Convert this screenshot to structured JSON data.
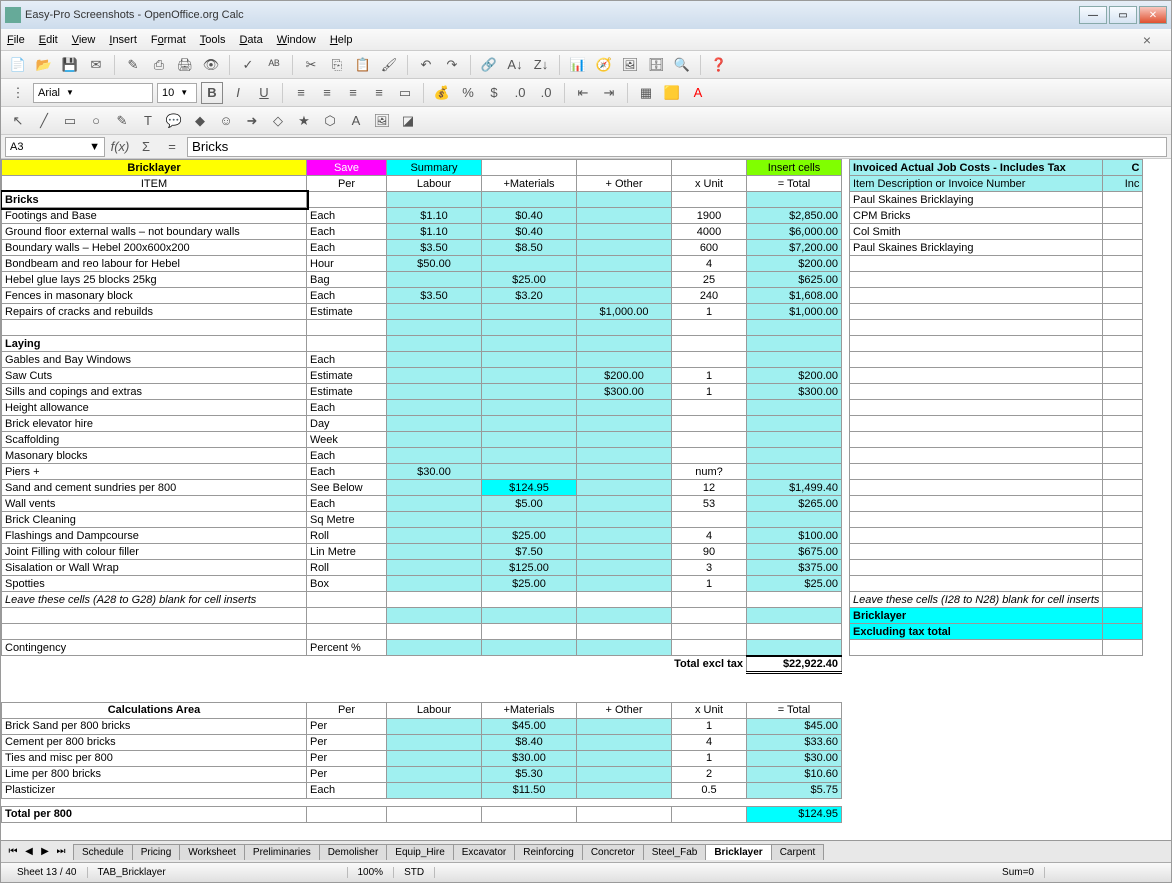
{
  "window_title": "Easy-Pro Screenshots - OpenOffice.org Calc",
  "menu": [
    "File",
    "Edit",
    "View",
    "Insert",
    "Format",
    "Tools",
    "Data",
    "Window",
    "Help"
  ],
  "font_name": "Arial",
  "font_size": "10",
  "cell_ref": "A3",
  "formula": "Bricks",
  "headers": {
    "bricklayer": "Bricklayer",
    "save": "Save",
    "summary": "Summary",
    "insert_cells": "Insert cells",
    "invoiced_title": "Invoiced Actual Job Costs - Includes Tax",
    "item": "ITEM",
    "per": "Per",
    "labour": "Labour",
    "materials": "+Materials",
    "other": "+ Other",
    "xunit": "x Unit",
    "total": "= Total",
    "item_desc": "Item Description or Invoice Number",
    "inc": "Inc",
    "inc_c": "C"
  },
  "sections": {
    "bricks": "Bricks",
    "laying": "Laying",
    "calc_area": "Calculations Area"
  },
  "rows": {
    "footings": {
      "item": "Footings and Base",
      "per": "Each",
      "lab": "$1.10",
      "mat": "$0.40",
      "unit": "1900",
      "tot": "$2,850.00"
    },
    "ground": {
      "item": "Ground floor external walls – not boundary walls",
      "per": "Each",
      "lab": "$1.10",
      "mat": "$0.40",
      "unit": "4000",
      "tot": "$6,000.00"
    },
    "boundary": {
      "item": "Boundary walls – Hebel 200x600x200",
      "per": "Each",
      "lab": "$3.50",
      "mat": "$8.50",
      "unit": "600",
      "tot": "$7,200.00"
    },
    "bondbeam": {
      "item": "Bondbeam and reo labour for Hebel",
      "per": "Hour",
      "lab": "$50.00",
      "unit": "4",
      "tot": "$200.00"
    },
    "hebelglue": {
      "item": "Hebel glue  lays 25 blocks 25kg",
      "per": "Bag",
      "mat": "$25.00",
      "unit": "25",
      "tot": "$625.00"
    },
    "fences": {
      "item": "Fences in masonary block",
      "per": "Each",
      "lab": "$3.50",
      "mat": "$3.20",
      "unit": "240",
      "tot": "$1,608.00"
    },
    "repairs": {
      "item": "Repairs of cracks and rebuilds",
      "per": "Estimate",
      "oth": "$1,000.00",
      "unit": "1",
      "tot": "$1,000.00"
    },
    "gables": {
      "item": "Gables and Bay Windows",
      "per": "Each"
    },
    "sawcuts": {
      "item": "Saw Cuts",
      "per": "Estimate",
      "oth": "$200.00",
      "unit": "1",
      "tot": "$200.00"
    },
    "sills": {
      "item": "Sills and copings and extras",
      "per": "Estimate",
      "oth": "$300.00",
      "unit": "1",
      "tot": "$300.00"
    },
    "height": {
      "item": "Height allowance",
      "per": "Each"
    },
    "elevator": {
      "item": "Brick elevator hire",
      "per": "Day"
    },
    "scaffold": {
      "item": "Scaffolding",
      "per": "Week"
    },
    "masonary": {
      "item": "Masonary blocks",
      "per": "Each"
    },
    "piers": {
      "item": "Piers +",
      "per": "Each",
      "lab": "$30.00",
      "unit": "num?"
    },
    "sand": {
      "item": "Sand and cement sundries per 800",
      "per": "See Below",
      "mat": "$124.95",
      "unit": "12",
      "tot": "$1,499.40"
    },
    "wallvents": {
      "item": "Wall vents",
      "per": "Each",
      "mat": "$5.00",
      "unit": "53",
      "tot": "$265.00"
    },
    "cleaning": {
      "item": "Brick Cleaning",
      "per": "Sq Metre"
    },
    "flashings": {
      "item": "Flashings and Dampcourse",
      "per": "Roll",
      "mat": "$25.00",
      "unit": "4",
      "tot": "$100.00"
    },
    "joint": {
      "item": "Joint Filling with colour filler",
      "per": "Lin Metre",
      "mat": "$7.50",
      "unit": "90",
      "tot": "$675.00"
    },
    "sisal": {
      "item": "Sisalation or Wall Wrap",
      "per": "Roll",
      "mat": "$125.00",
      "unit": "3",
      "tot": "$375.00"
    },
    "spotties": {
      "item": "Spotties",
      "per": "Box",
      "mat": "$25.00",
      "unit": "1",
      "tot": "$25.00"
    },
    "contingency": {
      "item": "Contingency",
      "per": "Percent %"
    },
    "bricksand": {
      "item": "Brick Sand per 800 bricks",
      "per": "Per",
      "mat": "$45.00",
      "unit": "1",
      "tot": "$45.00"
    },
    "cement": {
      "item": "Cement per 800 bricks",
      "per": "Per",
      "mat": "$8.40",
      "unit": "4",
      "tot": "$33.60"
    },
    "ties": {
      "item": "Ties and misc per 800",
      "per": "Per",
      "mat": "$30.00",
      "unit": "1",
      "tot": "$30.00"
    },
    "lime": {
      "item": "Lime per 800 bricks",
      "per": "Per",
      "mat": "$5.30",
      "unit": "2",
      "tot": "$10.60"
    },
    "plasticizer": {
      "item": "Plasticizer",
      "per": "Each",
      "mat": "$11.50",
      "unit": "0.5",
      "tot": "$5.75"
    },
    "totalper800": {
      "item": "Total per 800",
      "tot": "$124.95"
    }
  },
  "notes": {
    "leave1": "Leave these cells (A28 to G28) blank for cell inserts",
    "leave2": "Leave these cells (I28 to N28) blank for cell inserts",
    "total_excl": "Total excl tax",
    "total_val": "$22,922.40",
    "bricklayer_row": "Bricklayer",
    "excluding": "Excluding tax total"
  },
  "invoices": [
    "Paul Skaines Bricklaying",
    "CPM Bricks",
    "Col Smith",
    "Paul Skaines Bricklaying"
  ],
  "tabs": [
    "Schedule",
    "Pricing",
    "Worksheet",
    "Preliminaries",
    "Demolisher",
    "Equip_Hire",
    "Excavator",
    "Reinforcing",
    "Concretor",
    "Steel_Fab",
    "Bricklayer",
    "Carpent"
  ],
  "active_tab": "Bricklayer",
  "status": {
    "sheet": "Sheet 13 / 40",
    "tab": "TAB_Bricklayer",
    "zoom": "100%",
    "mode": "STD",
    "sum": "Sum=0"
  }
}
